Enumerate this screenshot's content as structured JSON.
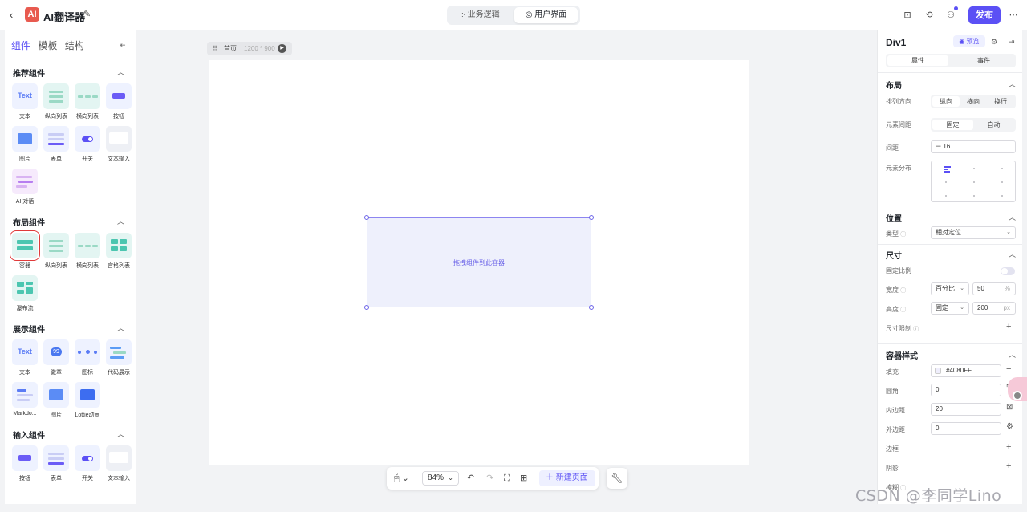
{
  "header": {
    "back_icon": "‹",
    "logo_text": "AI",
    "title": "AI翻译器",
    "edit_icon": "✎",
    "seg_logic": "჻ 业务逻辑",
    "seg_ui": "◎ 用户界面",
    "icons": [
      "save-icon",
      "history-icon",
      "user-icon",
      "more-icon"
    ],
    "icon_glyphs": {
      "save": "⊡",
      "history": "⟲",
      "user": "⚇",
      "more": "⋯"
    },
    "publish": "发布"
  },
  "left": {
    "tabs": [
      "组件",
      "模板",
      "结构"
    ],
    "collapse": "⇤",
    "sections": [
      {
        "title": "推荐组件",
        "items": [
          "文本",
          "纵向列表",
          "横向列表",
          "按钮",
          "图片",
          "表单",
          "开关",
          "文本输入",
          "AI 对话"
        ]
      },
      {
        "title": "布局组件",
        "items": [
          "容器",
          "纵向列表",
          "横向列表",
          "宫格列表",
          "瀑布流"
        ]
      },
      {
        "title": "展示组件",
        "items": [
          "文本",
          "徽章",
          "图标",
          "代码展示",
          "Markdo...",
          "图片",
          "Lottie动画"
        ]
      },
      {
        "title": "输入组件",
        "items": [
          "按钮",
          "表单",
          "开关",
          "文本输入"
        ]
      }
    ],
    "thumb_text": "Text",
    "badge_text": "99",
    "button_text": "Button",
    "chevron": "︿"
  },
  "canvas": {
    "page_name": "首页",
    "page_size": "1200 * 900",
    "drop_hint": "拖拽组件到此容器",
    "zoom": "84%",
    "new_page": "＋  新建页面"
  },
  "right": {
    "title": "Div1",
    "preview": "◉ 预览",
    "tabs": [
      "属性",
      "事件"
    ],
    "layout": {
      "title": "布局",
      "direction_label": "排列方向",
      "direction_options": [
        "纵向",
        "横向",
        "换行"
      ],
      "spacing_label": "元素间距",
      "spacing_options": [
        "固定",
        "自动"
      ],
      "gap_label": "间距",
      "gap_value": "16",
      "distribution_label": "元素分布"
    },
    "position": {
      "title": "位置",
      "type_label": "类型",
      "type_value": "相对定位"
    },
    "size": {
      "title": "尺寸",
      "ratio_label": "固定比例",
      "width_label": "宽度",
      "width_mode": "百分比",
      "width_value": "50",
      "width_unit": "%",
      "height_label": "高度",
      "height_mode": "固定",
      "height_value": "200",
      "height_unit": "px",
      "limit_label": "尺寸限制"
    },
    "container_style": {
      "title": "容器样式",
      "fill_label": "填充",
      "fill_value": "#4080FF",
      "radius_label": "圆角",
      "radius_value": "0",
      "padding_label": "内边距",
      "padding_value": "20",
      "margin_label": "外边距",
      "margin_value": "0",
      "border_label": "边框",
      "shadow_label": "阴影",
      "blur_label": "模糊"
    }
  },
  "watermark": "CSDN @李同学Lino",
  "colors": {
    "accent": "#5b50f5",
    "selection": "#e03a3a",
    "canvas_bg": "#f2f3f5"
  }
}
